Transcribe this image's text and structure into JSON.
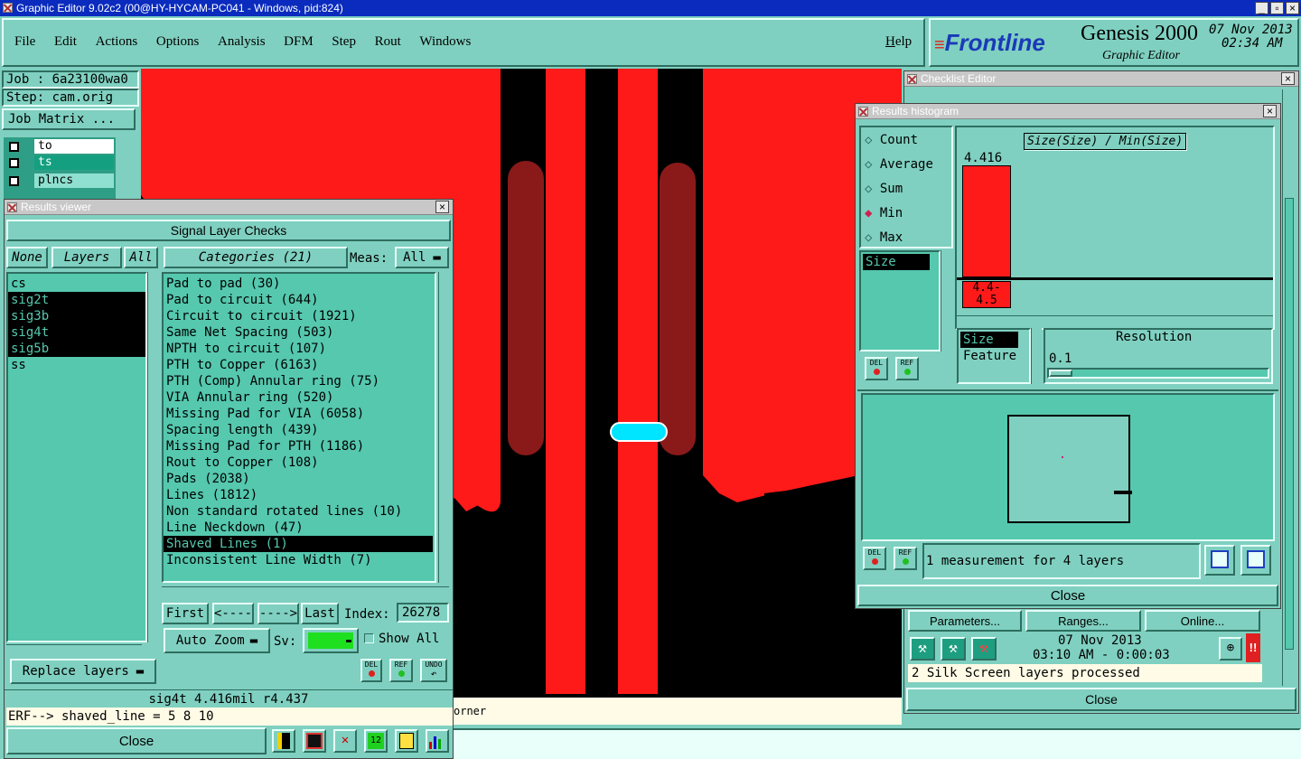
{
  "window": {
    "title": "Graphic Editor 9.02c2 (00@HY-HYCAM-PC041 - Windows, pid:824)"
  },
  "menu": [
    "File",
    "Edit",
    "Actions",
    "Options",
    "Analysis",
    "DFM",
    "Step",
    "Rout",
    "Windows"
  ],
  "help_label": "Help",
  "brand": {
    "logo": "Frontline",
    "product": "Genesis 2000",
    "subtitle": "Graphic Editor",
    "date": "07 Nov 2013",
    "time": "02:34 AM"
  },
  "job": {
    "job": "Job : 6a23100wa0",
    "step": "Step: cam.orig",
    "matrix_button": "Job Matrix ..."
  },
  "layer_panel": [
    {
      "name": "to"
    },
    {
      "name": "ts"
    },
    {
      "name": "plncs"
    }
  ],
  "results_viewer": {
    "title": "Results viewer",
    "header": "Signal Layer Checks",
    "none_btn": "None",
    "layers_btn": "Layers",
    "all_btn": "All",
    "layers": [
      "cs",
      "sig2t",
      "sig3b",
      "sig4t",
      "sig5b",
      "ss"
    ],
    "selected_layers": [
      "sig2t",
      "sig3b",
      "sig4t",
      "sig5b"
    ],
    "categories_btn": "Categories (21)",
    "meas_label": "Meas:",
    "meas_value": "All",
    "categories": [
      "Pad to pad (30)",
      "Pad to circuit (644)",
      "Circuit to circuit (1921)",
      "Same Net Spacing (503)",
      "NPTH to circuit (107)",
      "PTH to Copper (6163)",
      "PTH (Comp) Annular ring (75)",
      "VIA Annular ring (520)",
      "Missing Pad for VIA (6058)",
      "Spacing length (439)",
      "Missing Pad for PTH (1186)",
      "Rout to Copper (108)",
      "Pads (2038)",
      "Lines (1812)",
      "Non standard rotated lines (10)",
      "Line Neckdown (47)",
      "Shaved Lines (1)",
      "Inconsistent Line Width (7)"
    ],
    "selected_category": "Shaved Lines (1)",
    "first": "First",
    "prev": "<----",
    "next": "---->",
    "last": "Last",
    "index_label": "Index:",
    "index_value": "26278",
    "auto_zoom": "Auto Zoom",
    "sv_label": "Sv:",
    "show_all": "Show All",
    "replace_layers": "Replace layers",
    "del": "DEL",
    "ref": "REF",
    "undo": "UNDO",
    "status": "sig4t 4.416mil   r4.437",
    "erf": "ERF--> shaved_line = 5 8 10",
    "close": "Close"
  },
  "histogram": {
    "title": "Results histogram",
    "options": [
      "Count",
      "Average",
      "Sum",
      "Min",
      "Max"
    ],
    "selected_option": "Min",
    "attr_list": [
      "Size"
    ],
    "graph_label": "Size(Size) / Min(Size)",
    "bar_value": "4.416",
    "bar_range": "4.4-\n4.5",
    "res_list": [
      "Size",
      "Feature"
    ],
    "resolution_label": "Resolution",
    "resolution_value": "0.1",
    "measurement_text": "1 measurement for 4 layers",
    "close": "Close"
  },
  "checklist": {
    "title": "Checklist Editor",
    "params": "Parameters...",
    "ranges": "Ranges...",
    "online": "Online...",
    "date": "07 Nov 2013",
    "time": "03:10 AM - 0:00:03",
    "status": "2 Silk Screen layers processed",
    "close": "Close"
  },
  "bottom": {
    "corner_text": "orner"
  },
  "colors": {
    "bg": "#7fd0c0",
    "list": "#55c8ae",
    "copper": "#ff1a1a",
    "board": "#000000",
    "highlight": "#00e5ff"
  }
}
